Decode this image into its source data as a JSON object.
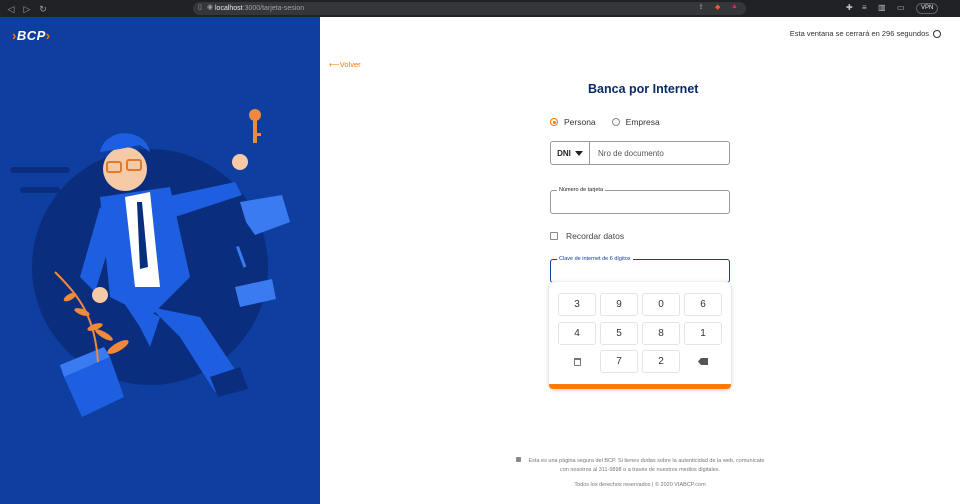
{
  "browser": {
    "url_host": "localhost",
    "url_path": ":3000/tarjeta-sesion",
    "vpn_label": "VPN"
  },
  "brand": {
    "logo_text": "BCP"
  },
  "header": {
    "timer_text": "Esta ventana se cerrará en 296 segundos",
    "back_label": "Volver"
  },
  "form": {
    "title": "Banca por Internet",
    "radio_persona": "Persona",
    "radio_empresa": "Empresa",
    "selected_radio": "Persona",
    "doc_type": "DNI",
    "doc_placeholder": "Nro de documento",
    "card_label": "Número de tarjeta",
    "remember_label": "Recordar datos",
    "pin_label": "Clave de internet de 6 dígitos"
  },
  "keypad": {
    "row1": [
      "3",
      "9",
      "0",
      "6"
    ],
    "row2": [
      "4",
      "5",
      "8",
      "1"
    ],
    "row3": [
      "7",
      "2"
    ]
  },
  "footer": {
    "security_text_1": "Esta es una página segura del BCP. Si tienes dudas sobre la autenticidad de la web, comunícate",
    "security_text_2": "con nosotros al 311-9898 o a través de nuestros medios digitales.",
    "rights": "Todos los derechos reservados  |  © 2020 VIABCP.com"
  },
  "colors": {
    "brand_blue": "#0f3ea1",
    "accent_orange": "#ff7800",
    "title_navy": "#0a2a66"
  }
}
